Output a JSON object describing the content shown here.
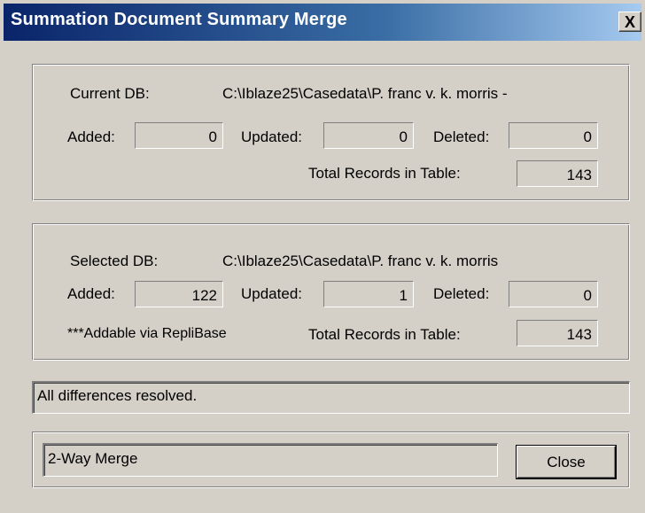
{
  "window": {
    "title": "Summation Document Summary Merge",
    "close_glyph": "X"
  },
  "current_db": {
    "label": "Current DB:",
    "path": "C:\\Iblaze25\\Casedata\\P. franc v. k. morris -",
    "added_label": "Added:",
    "added_value": "0",
    "updated_label": "Updated:",
    "updated_value": "0",
    "deleted_label": "Deleted:",
    "deleted_value": "0",
    "total_label": "Total Records in Table:",
    "total_value": "143"
  },
  "selected_db": {
    "label": "Selected DB:",
    "path": "C:\\Iblaze25\\Casedata\\P. franc v. k. morris",
    "added_label": "Added:",
    "added_value": "122",
    "updated_label": "Updated:",
    "updated_value": "1",
    "deleted_label": "Deleted:",
    "deleted_value": "0",
    "note": "***Addable via RepliBase",
    "total_label": "Total Records in Table:",
    "total_value": "143"
  },
  "status": {
    "message": "All differences resolved."
  },
  "merge": {
    "mode_text": "2-Way Merge",
    "close_label": "Close"
  }
}
